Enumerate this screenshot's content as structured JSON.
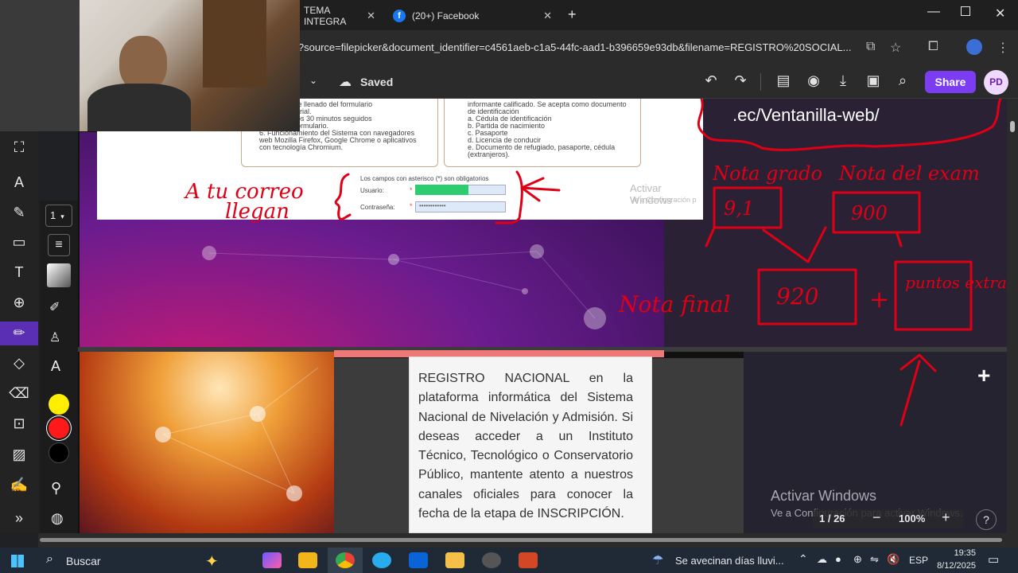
{
  "browser": {
    "tabs": [
      {
        "label": "TEMA INTEGRA"
      },
      {
        "label": "(20+) Facebook"
      }
    ],
    "url": "l?source=filepicker&document_identifier=c4561aeb-c1a5-44fc-aad1-b396659e93db&filename=REGISTRO%20SOCIAL..."
  },
  "app_toolbar": {
    "status": "Saved",
    "share_label": "Share",
    "avatar_initials": "PD",
    "page_selector": "1"
  },
  "left_panel": {
    "colors": [
      "#ffee00",
      "#ff1a1a",
      "#000000"
    ],
    "selected_color": "#ff1a1a"
  },
  "document": {
    "instructions_left": "...structivo de llenado del formulario\n...l video tutorial.\n...de al menos 30 minutos seguidos\n...nado del formulario.\n6. Funcionamiento del Sistema con navegadores web Mozilla Firefox, Google Chrome o aplicativos con tecnología Chromium.",
    "instructions_right": "informante calificado. Se acepta como documento de identificación\na. Cédula de identificación\nb. Partida de nacimiento\nc. Pasaporte\nd. Licencia de conducir\ne. Documento de refugiado, pasaporte, cédula (extranjeros).",
    "required_note": "Los campos con asterisco (*) son obligatorios",
    "user_label": "Usuario:",
    "password_label": "Contraseña:",
    "password_value": "••••••••••••",
    "watermark_top_line1": "Activar Windows",
    "watermark_top_line2": "Ve a Configuración p"
  },
  "annotations": {
    "url_fragment": ".ec/Ventanilla-web/",
    "correo_line1": "A tu correo",
    "correo_line2": "llegan",
    "nota_grado_label": "Nota grado",
    "nota_grado_value": "9,1",
    "nota_examen_label": "Nota del exam",
    "nota_examen_value": "900",
    "nota_final_label": "Nota final",
    "nota_final_value": "920",
    "plus": "+",
    "puntos_extras": "puntos extras"
  },
  "registro": {
    "text": "REGISTRO NACIONAL en la plataforma informática del Sistema Nacional de Nivelación y Admisión. Si deseas acceder a un Instituto Técnico, Tecnológico o Conservatorio Público, mantente atento a nuestros canales oficiales para conocer la fecha de la etapa de INSCRIPCIÓN."
  },
  "viewer": {
    "watermark_line1": "Activar Windows",
    "watermark_line2": "Ve a Configuración para activar Windows.",
    "page_indicator": "1 / 26",
    "zoom": "100%",
    "help": "?"
  },
  "taskbar": {
    "search_placeholder": "Buscar",
    "weather": "Se avecinan días lluvi...",
    "language": "ESP",
    "time": "19:35",
    "date": "8/12/2025"
  }
}
